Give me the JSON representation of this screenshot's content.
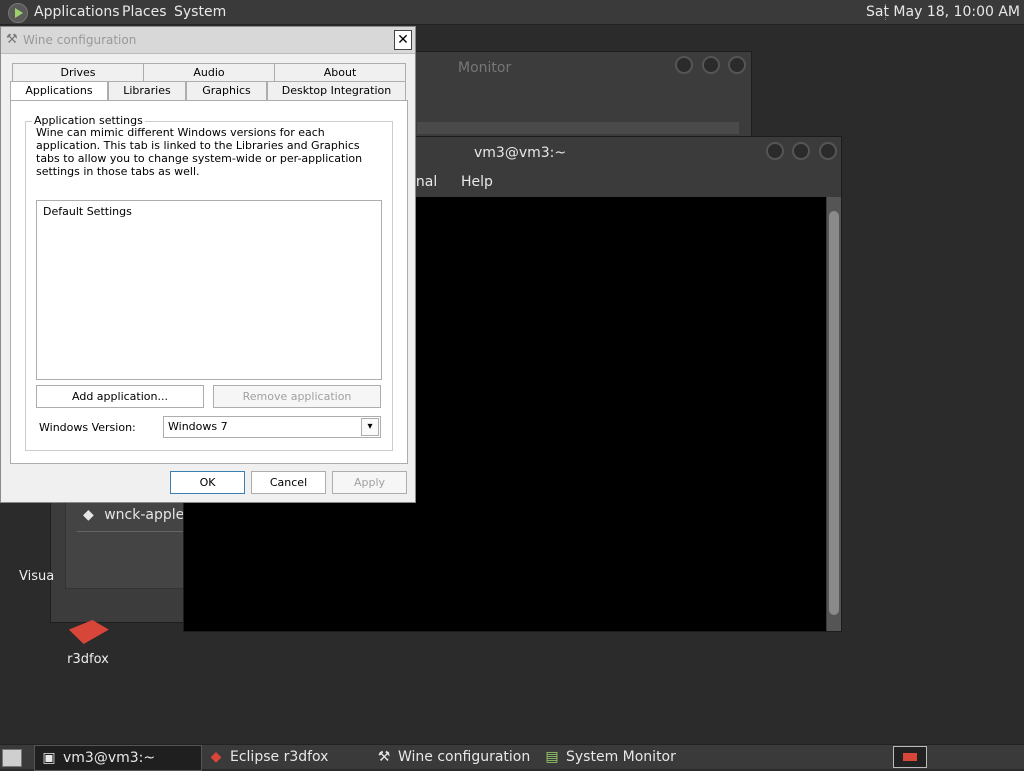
{
  "top_panel": {
    "menus": [
      "Applications",
      "Places",
      "System"
    ],
    "clock": "Sat May 18, 10:00 AM"
  },
  "sysmon_window": {
    "title": "Monitor",
    "applet_label": "wnck-applet"
  },
  "terminal_window": {
    "title": "vm3@vm3:~",
    "menu": [
      "inal",
      "Help"
    ]
  },
  "desktop": {
    "visual_label": "Visua",
    "r3dfox_label": "r3dfox"
  },
  "wine": {
    "title": "Wine configuration",
    "tabs_row1": [
      "Drives",
      "Audio",
      "About"
    ],
    "tabs_row2": [
      "Applications",
      "Libraries",
      "Graphics",
      "Desktop Integration"
    ],
    "group_label": "Application settings",
    "description": "Wine can mimic different Windows versions for each application. This tab is linked to the Libraries and Graphics tabs to allow you to change system-wide or per-application settings in those tabs as well.",
    "list_items": [
      "Default Settings"
    ],
    "add_button": "Add application...",
    "remove_button": "Remove application",
    "version_label": "Windows Version:",
    "version_value": "Windows 7",
    "ok": "OK",
    "cancel": "Cancel",
    "apply": "Apply"
  },
  "taskbar": {
    "tasks": [
      "vm3@vm3:~",
      "Eclipse r3dfox",
      "Wine configuration",
      "System Monitor"
    ]
  }
}
